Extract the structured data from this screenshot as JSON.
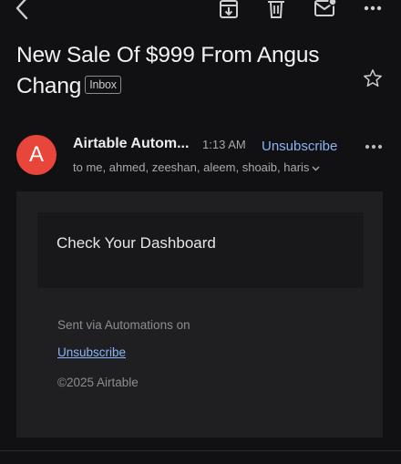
{
  "toolbar": {
    "icons": [
      "back-icon",
      "archive-icon",
      "trash-icon",
      "mark-unread-icon",
      "more-icon"
    ]
  },
  "subject": {
    "text": "New Sale Of $999 From Angus Chang",
    "label_chip": "Inbox"
  },
  "message": {
    "avatar_letter": "A",
    "sender": "Airtable Autom...",
    "time": "1:13 AM",
    "unsubscribe": "Unsubscribe",
    "recipients": "to me, ahmed, zeeshan, aleem, shoaib, haris"
  },
  "body": {
    "cta_text": "Check Your Dashboard",
    "sent_via": "Sent via Automations on",
    "unsubscribe_link": "Unsubscribe",
    "copyright": "©2025 Airtable"
  },
  "colors": {
    "background": "#111113",
    "avatar": "#e8463a",
    "link": "#8ab4f8"
  }
}
